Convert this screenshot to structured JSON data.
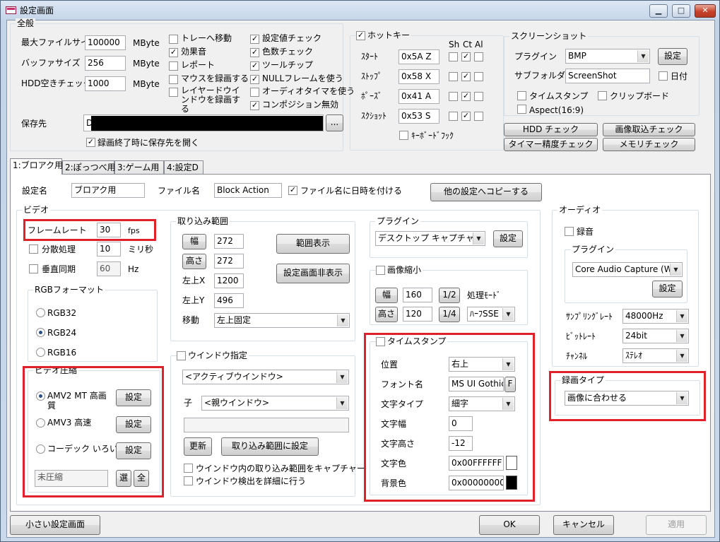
{
  "window": {
    "title": "設定画面",
    "min": "▁",
    "max": "□",
    "close": "✕"
  },
  "general": {
    "title": "全般",
    "max_file_size_label": "最大ファイルサイズ",
    "max_file_size": "100000",
    "unit1": "MByte",
    "buffer_size_label": "バッファサイズ",
    "buffer_size": "256",
    "unit2": "MByte",
    "hdd_check_label": "HDD空きチェック",
    "hdd_check": "1000",
    "unit3": "MByte",
    "save_to_label": "保存先",
    "save_to_prefix": "D:",
    "browse": "...",
    "open_after": "録画終了時に保存先を開く",
    "checks_col1": [
      {
        "label": "トレーへ移動",
        "checked": false
      },
      {
        "label": "効果音",
        "checked": true
      },
      {
        "label": "レポート",
        "checked": false
      },
      {
        "label": "マウスを録画する",
        "checked": false
      },
      {
        "label": "レイヤードウインドウを録画する",
        "checked": false
      }
    ],
    "checks_col2": [
      {
        "label": "設定値チェック",
        "checked": true
      },
      {
        "label": "色数チェック",
        "checked": true
      },
      {
        "label": "ツールチップ",
        "checked": true
      },
      {
        "label": "NULLフレームを使う",
        "checked": true
      },
      {
        "label": "オーディオタイマを使う",
        "checked": false
      },
      {
        "label": "コンポジション無効",
        "checked": true
      }
    ]
  },
  "hotkey": {
    "title": "ホットキー",
    "headers": [
      "Sh",
      "Ct",
      "Al"
    ],
    "rows": [
      {
        "label": "ｽﾀｰﾄ",
        "value": "0x5A Z",
        "sh": false,
        "ct": true,
        "al": false
      },
      {
        "label": "ｽﾄｯﾌﾟ",
        "value": "0x58 X",
        "sh": false,
        "ct": true,
        "al": false
      },
      {
        "label": "ﾎﾟｰｽﾞ",
        "value": "0x41 A",
        "sh": false,
        "ct": true,
        "al": false
      },
      {
        "label": "ｽｸｼｮｯﾄ",
        "value": "0x53 S",
        "sh": false,
        "ct": true,
        "al": false
      }
    ],
    "keyboard_hook": "ｷｰﾎﾞｰﾄﾞﾌｯｸ"
  },
  "screenshot": {
    "title": "スクリーンショット",
    "plugin_label": "プラグイン",
    "plugin": "BMP",
    "settings": "設定",
    "subfolder_label": "サブフォルダ",
    "subfolder": "ScreenShot",
    "date": "日付",
    "timestamp": "タイムスタンプ",
    "clipboard": "クリップボード",
    "aspect": "Aspect(16:9)"
  },
  "buttons": {
    "hdd_check": "HDD チェック",
    "image_check": "画像取込チェック",
    "timer_check": "タイマー精度チェック",
    "memory_check": "メモリチェック"
  },
  "tabs": [
    "1:ブロアク用",
    "2:ぽっつべ用",
    "3:ゲーム用",
    "4:設定D"
  ],
  "profile": {
    "name_label": "設定名",
    "name": "ブロアク用",
    "file_label": "ファイル名",
    "file": "Block Action",
    "date_label": "ファイル名に日時を付ける",
    "copy": "他の設定へコピーする"
  },
  "video": {
    "title": "ビデオ",
    "fps_label": "フレームレート",
    "fps": "30",
    "fps_unit": "fps",
    "split_label": "分散処理",
    "split": "10",
    "split_unit": "ミリ秒",
    "vsync_label": "垂直同期",
    "vsync": "60",
    "vsync_unit": "Hz",
    "rgb_title": "RGBフォーマット",
    "rgb": [
      "RGB32",
      "RGB24",
      "RGB16"
    ],
    "rgb_selected": 1,
    "comp_title": "ビデオ圧縮",
    "comp": [
      "AMV2 MT 高画質",
      "AMV3 高速",
      "コーデック いろいろ"
    ],
    "comp_set": "設定",
    "comp_value": "未圧縮",
    "sel": "選",
    "all": "全"
  },
  "capture": {
    "title": "取り込み範囲",
    "width_label": "幅",
    "width": "272",
    "height_label": "高さ",
    "height": "272",
    "left_label": "左上X",
    "left": "1200",
    "top_label": "左上Y",
    "top": "496",
    "move_label": "移動",
    "move": "左上固定",
    "show_range": "範囲表示",
    "hide_settings": "設定画面非表示"
  },
  "window_spec": {
    "title": "ウインドウ指定",
    "window": "<アクティブウインドウ>",
    "child_label": "子",
    "child": "<親ウインドウ>",
    "update": "更新",
    "set_range": "取り込み範囲に設定",
    "opt1": "ウインドウ内の取り込み範囲をキャプチャー",
    "opt2": "ウインドウ検出を詳細に行う"
  },
  "vplugin": {
    "title": "プラグイン",
    "value": "デスクトップ キャプチャー",
    "settings": "設定"
  },
  "shrink": {
    "title": "画像縮小",
    "w_label": "幅",
    "w": "160",
    "w_ratio": "1/2",
    "h_label": "高さ",
    "h": "120",
    "h_ratio": "1/4",
    "mode_label": "処理ﾓｰﾄﾞ",
    "mode": "ﾊｰﾌSSE"
  },
  "timestamp": {
    "title": "タイムスタンプ",
    "pos_label": "位置",
    "pos": "右上",
    "font_label": "フォント名",
    "font": "MS UI Gothic",
    "font_btn": "F",
    "type_label": "文字タイプ",
    "type": "細字",
    "w_label": "文字幅",
    "w": "0",
    "h_label": "文字高さ",
    "h": "-12",
    "color_label": "文字色",
    "color": "0x00FFFFFF",
    "bg_label": "背景色",
    "bg": "0x00000000",
    "swatch_fg": "#ffffff",
    "swatch_bg": "#000000"
  },
  "audio": {
    "title": "オーディオ",
    "record": "録音",
    "plugin_title": "プラグイン",
    "plugin": "Core Audio Capture (Wi",
    "settings": "設定",
    "rate_label": "ｻﾝﾌﾟﾘﾝｸﾞﾚｰﾄ",
    "rate": "48000Hz",
    "bits_label": "ﾋﾞｯﾄﾚｰﾄ",
    "bits": "24bit",
    "ch_label": "ﾁｬﾝﾈﾙ",
    "ch": "ｽﾃﾚｵ"
  },
  "rec_type": {
    "title": "録画タイプ",
    "value": "画像に合わせる"
  },
  "footer": {
    "small": "小さい設定画面",
    "ok": "OK",
    "cancel": "キャンセル",
    "apply": "適用"
  },
  "colors": {
    "highlight": "#e0202a"
  }
}
